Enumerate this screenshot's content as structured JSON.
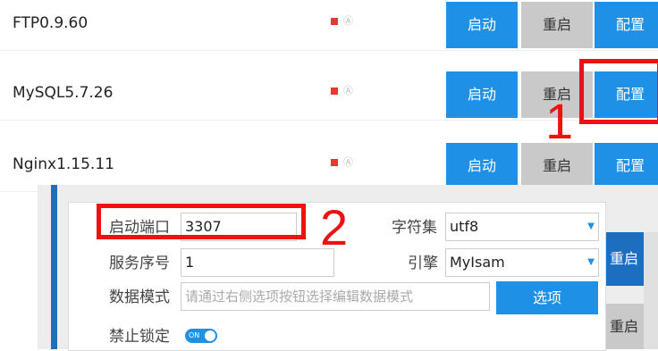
{
  "services": [
    {
      "name": "FTP0.9.60",
      "start": "启动",
      "restart": "重启",
      "config": "配置"
    },
    {
      "name": "MySQL5.7.26",
      "start": "启动",
      "restart": "重启",
      "config": "配置"
    },
    {
      "name": "Nginx1.15.11",
      "start": "启动",
      "restart": "重启",
      "config": "配置"
    }
  ],
  "status_icon": "Ⓐ",
  "annotations": {
    "one": "1",
    "two": "2"
  },
  "background_buttons": {
    "restart1": "重启",
    "restart2": "重启"
  },
  "form": {
    "port_label": "启动端口",
    "port_value": "3307",
    "charset_label": "字符集",
    "charset_value": "utf8",
    "server_id_label": "服务序号",
    "server_id_value": "1",
    "engine_label": "引擎",
    "engine_value": "MyIsam",
    "mode_label": "数据模式",
    "mode_placeholder": "请通过右侧选项按钮选择编辑数据模式",
    "choose_button": "选项",
    "lock_label": "禁止锁定",
    "lock_toggle": "ON"
  },
  "colors": {
    "primary": "#1e90e6",
    "annotation": "#ee1111",
    "status": "#e53935"
  }
}
